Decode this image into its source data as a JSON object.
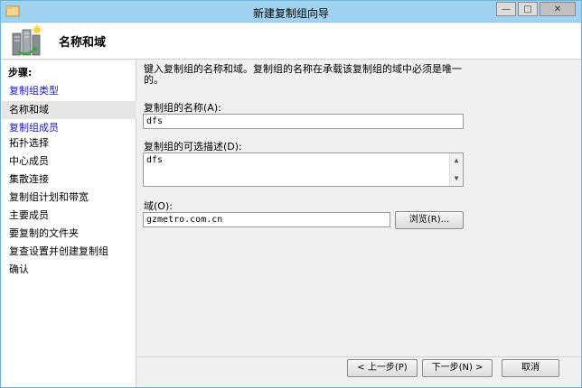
{
  "window": {
    "title": "新建复制组向导"
  },
  "header": {
    "title": "名称和域"
  },
  "sidebar": {
    "steps_label": "步骤:",
    "items": [
      {
        "label": "复制组类型",
        "state": "link"
      },
      {
        "label": "名称和域",
        "state": "current"
      },
      {
        "label": "复制组成员",
        "state": "link"
      },
      {
        "label": "拓扑选择",
        "state": "normal"
      },
      {
        "label": "中心成员",
        "state": "normal"
      },
      {
        "label": "集散连接",
        "state": "normal"
      },
      {
        "label": "复制组计划和带宽",
        "state": "normal"
      },
      {
        "label": "主要成员",
        "state": "normal"
      },
      {
        "label": "要复制的文件夹",
        "state": "normal"
      },
      {
        "label": "复查设置并创建复制组",
        "state": "normal"
      },
      {
        "label": "确认",
        "state": "normal"
      }
    ]
  },
  "main": {
    "description": "键入复制组的名称和域。复制组的名称在承载该复制组的域中必须是唯一的。",
    "name_label": "复制组的名称(A):",
    "name_value": "dfs",
    "desc_label": "复制组的可选描述(D):",
    "desc_value": "dfs",
    "domain_label": "域(O):",
    "domain_value": "gzmetro.com.cn",
    "browse_button": "浏览(R)..."
  },
  "footer": {
    "back_button": "< 上一步(P)",
    "next_button": "下一步(N) >",
    "cancel_button": "取消"
  },
  "colors": {
    "link": "#1a1ab8",
    "titlebar": "#9fd2f0",
    "current_step_bg": "#e6e6e6"
  }
}
